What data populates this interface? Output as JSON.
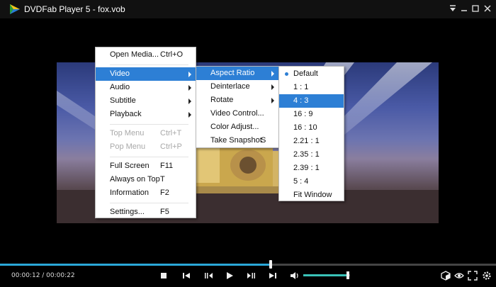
{
  "window": {
    "title": "DVDFab Player 5 - fox.vob"
  },
  "main_menu": [
    {
      "label": "Open Media...",
      "shortcut": "Ctrl+O",
      "state": "normal"
    },
    {
      "separator": true
    },
    {
      "label": "Video",
      "shortcut": "",
      "state": "active",
      "submenu": true
    },
    {
      "label": "Audio",
      "shortcut": "",
      "state": "normal",
      "submenu": true
    },
    {
      "label": "Subtitle",
      "shortcut": "",
      "state": "normal",
      "submenu": true
    },
    {
      "label": "Playback",
      "shortcut": "",
      "state": "normal",
      "submenu": true
    },
    {
      "separator": true
    },
    {
      "label": "Top Menu",
      "shortcut": "Ctrl+T",
      "state": "disabled"
    },
    {
      "label": "Pop Menu",
      "shortcut": "Ctrl+P",
      "state": "disabled"
    },
    {
      "separator": true
    },
    {
      "label": "Full Screen",
      "shortcut": "F11",
      "state": "normal"
    },
    {
      "label": "Always on Top",
      "shortcut": "T",
      "state": "normal"
    },
    {
      "label": "Information",
      "shortcut": "F2",
      "state": "normal"
    },
    {
      "separator": true
    },
    {
      "label": "Settings...",
      "shortcut": "F5",
      "state": "normal"
    }
  ],
  "video_menu": [
    {
      "label": "Aspect Ratio",
      "shortcut": "",
      "state": "active",
      "submenu": true
    },
    {
      "label": "Deinterlace",
      "shortcut": "",
      "state": "normal",
      "submenu": true
    },
    {
      "label": "Rotate",
      "shortcut": "",
      "state": "normal",
      "submenu": true
    },
    {
      "label": "Video Control...",
      "shortcut": "",
      "state": "normal"
    },
    {
      "label": "Color Adjust...",
      "shortcut": "",
      "state": "normal"
    },
    {
      "label": "Take Snapshot",
      "shortcut": "S",
      "state": "normal"
    }
  ],
  "aspect_menu": [
    {
      "label": "Default",
      "checked": true,
      "state": "normal"
    },
    {
      "label": "1 : 1",
      "state": "normal"
    },
    {
      "label": "4 : 3",
      "state": "active"
    },
    {
      "label": "16 : 9",
      "state": "normal"
    },
    {
      "label": "16 : 10",
      "state": "normal"
    },
    {
      "label": "2.21 : 1",
      "state": "normal"
    },
    {
      "label": "2.35 : 1",
      "state": "normal"
    },
    {
      "label": "2.39 : 1",
      "state": "normal"
    },
    {
      "label": "5 : 4",
      "state": "normal"
    },
    {
      "label": "Fit Window",
      "state": "normal"
    }
  ],
  "playback": {
    "time_display": "00:00:12 / 00:00:22",
    "progress": 0.545,
    "volume": 0.95
  },
  "colors": {
    "accent": "#2d7fd5",
    "seek": "#2aa7d8",
    "volume": "#3ac2b8"
  },
  "icons": [
    "app-logo-icon",
    "menu-down-icon",
    "minimize-icon",
    "restore-icon",
    "close-icon",
    "stop-icon",
    "previous-chapter-icon",
    "step-back-icon",
    "play-icon",
    "step-forward-icon",
    "next-chapter-icon",
    "volume-icon",
    "3d-icon",
    "eye-icon",
    "fullscreen-icon",
    "settings-icon"
  ]
}
